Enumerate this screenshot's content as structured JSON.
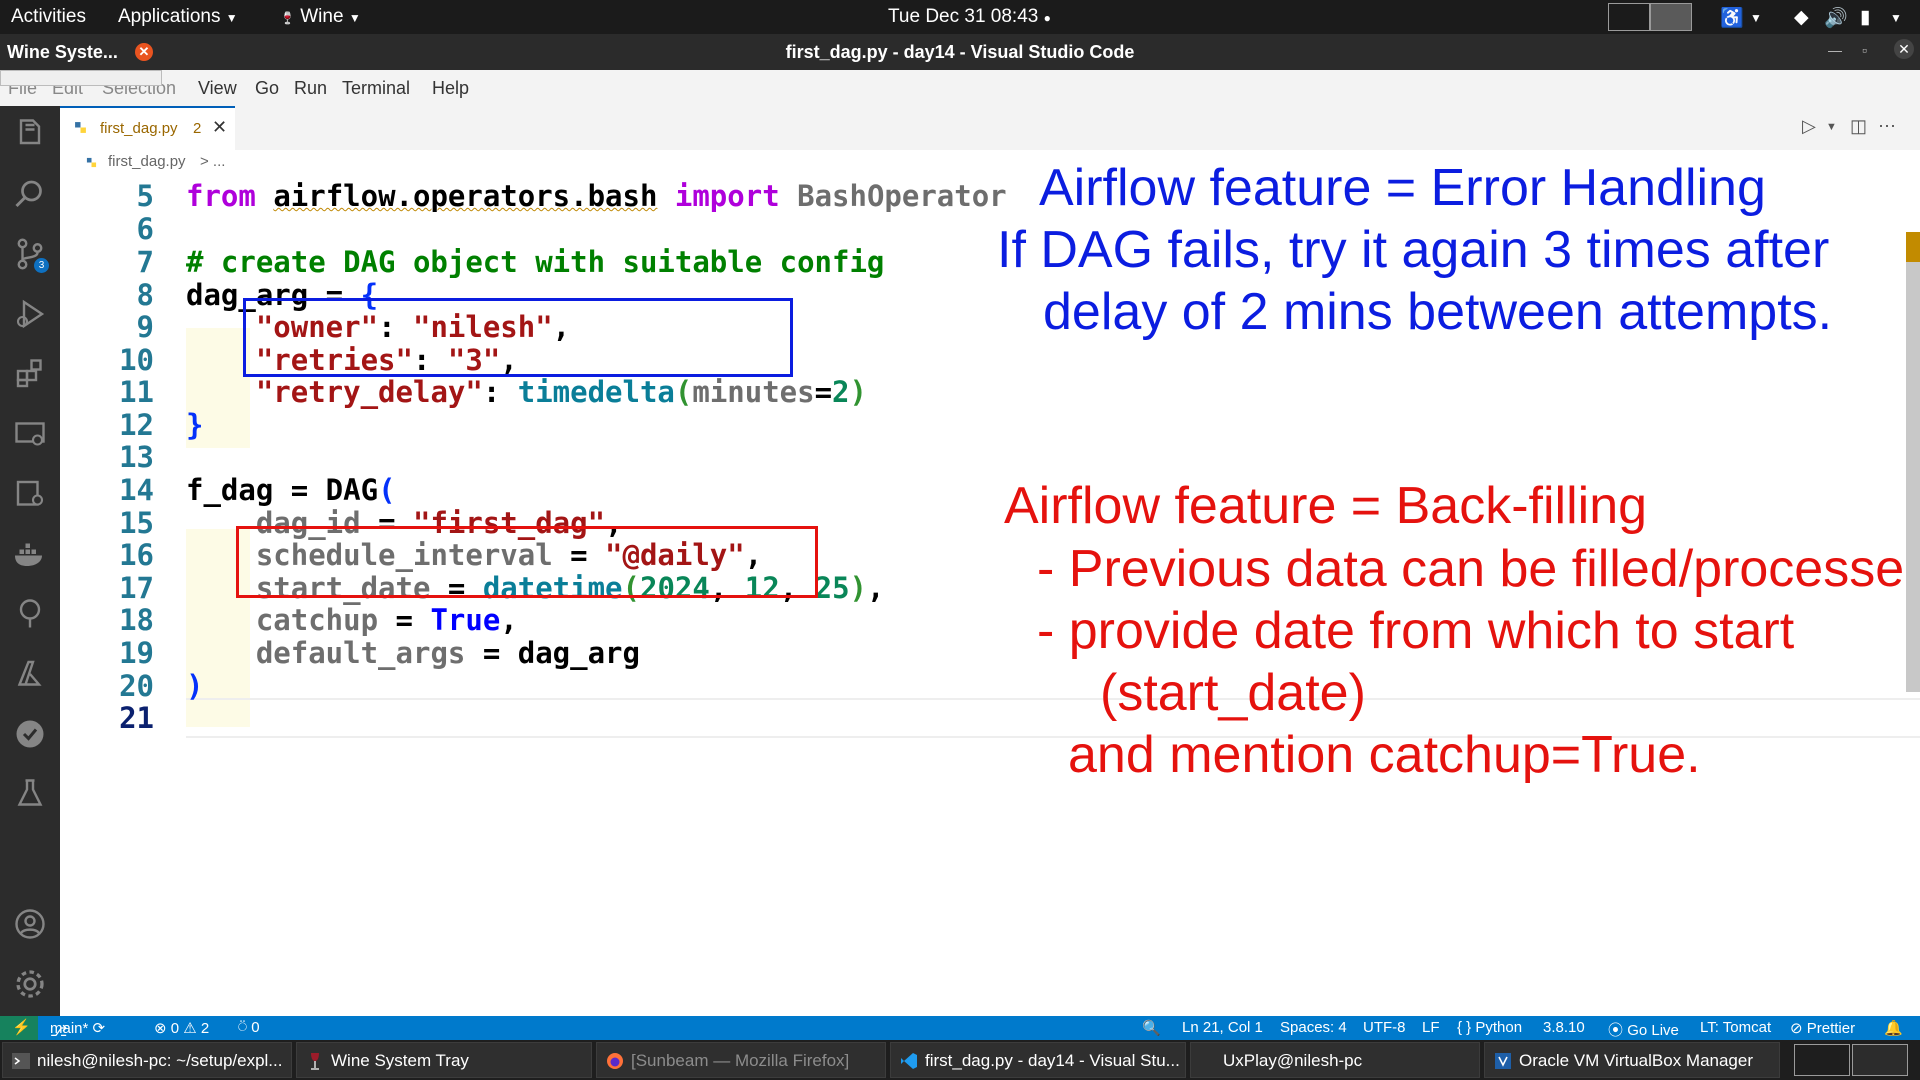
{
  "topbar": {
    "activities": "Activities",
    "applications": "Applications",
    "wine": "Wine",
    "clock": "Tue Dec 31  08:43"
  },
  "wine_popup": {
    "title": "Wine Syste..."
  },
  "window": {
    "title": "first_dag.py - day14 - Visual Studio Code"
  },
  "menu": [
    "File",
    "Edit",
    "Selection",
    "View",
    "Go",
    "Run",
    "Terminal",
    "Help"
  ],
  "editor_tab": {
    "filename": "first_dag.py",
    "problems": "2"
  },
  "breadcrumb": {
    "file": "first_dag.py",
    "sep": "> ..."
  },
  "line_numbers": [
    "5",
    "6",
    "7",
    "8",
    "9",
    "10",
    "11",
    "12",
    "13",
    "14",
    "15",
    "16",
    "17",
    "18",
    "19",
    "20",
    "21"
  ],
  "code": {
    "l5": {
      "kw_from": "from",
      "module": "airflow.operators.bash",
      "kw_import": "import",
      "name": "BashOperator"
    },
    "l7": {
      "comment": "# create DAG object with suitable config"
    },
    "l8": {
      "var": "dag_arg = ",
      "brace": "{"
    },
    "l9": {
      "key": "\"owner\"",
      "colon": ": ",
      "val": "\"nilesh\"",
      "comma": ","
    },
    "l10": {
      "key": "\"retries\"",
      "colon": ": ",
      "val": "\"3\"",
      "comma": ","
    },
    "l11": {
      "key": "\"retry_delay\"",
      "colon": ": ",
      "fn": "timedelta",
      "open": "(",
      "param": "minutes",
      "eq": "=",
      "num": "2",
      "close": ")"
    },
    "l12": {
      "brace": "}"
    },
    "l14": {
      "var": "f_dag = DAG",
      "paren": "("
    },
    "l15": {
      "param": "dag_id",
      "eq": " = ",
      "val": "\"first_dag\"",
      "comma": ","
    },
    "l16": {
      "param": "schedule_interval",
      "eq": " = ",
      "val": "\"@daily\"",
      "comma": ","
    },
    "l17": {
      "param": "start_date",
      "eq": " = ",
      "fn": "datetime",
      "open": "(",
      "y": "2024",
      "c1": ", ",
      "m": "12",
      "c2": ", ",
      "d": "25",
      "close": ")",
      "comma": ","
    },
    "l18": {
      "param": "catchup",
      "eq": " = ",
      "val": "True",
      "comma": ","
    },
    "l19": {
      "param": "default_args",
      "eq": " = ",
      "val": "dag_arg"
    },
    "l20": {
      "paren": ")"
    }
  },
  "annotations": {
    "blue": [
      "Airflow feature = Error Handling",
      "If DAG fails, try it again 3 times after",
      "delay of 2 mins between attempts."
    ],
    "red": [
      "Airflow feature = Back-filling",
      "- Previous data can be filled/processed",
      "- provide date from which to start",
      "(start_date)",
      "and mention catchup=True."
    ],
    "colors": {
      "blue": "#0b1de0",
      "red": "#e5120e"
    }
  },
  "statusbar": {
    "branch": "main*",
    "errors": "0",
    "warnings": "2",
    "ports": "0",
    "position": "Ln 21, Col 1",
    "spaces": "Spaces: 4",
    "encoding": "UTF-8",
    "eol": "LF",
    "language": "Python",
    "python_version": "3.8.10",
    "go_live": "Go Live",
    "tomcat": "LT: Tomcat",
    "prettier": "Prettier",
    "color": "#007acc"
  },
  "taskbar": [
    {
      "label": "nilesh@nilesh-pc: ~/setup/expl...",
      "icon": "terminal-icon"
    },
    {
      "label": "Wine System Tray",
      "icon": "wine-icon"
    },
    {
      "label": "[Sunbeam — Mozilla Firefox]",
      "icon": "firefox-icon"
    },
    {
      "label": "first_dag.py - day14 - Visual Stu...",
      "icon": "vscode-icon"
    },
    {
      "label": "UxPlay@nilesh-pc",
      "icon": ""
    },
    {
      "label": "Oracle VM VirtualBox Manager",
      "icon": "virtualbox-icon"
    }
  ]
}
